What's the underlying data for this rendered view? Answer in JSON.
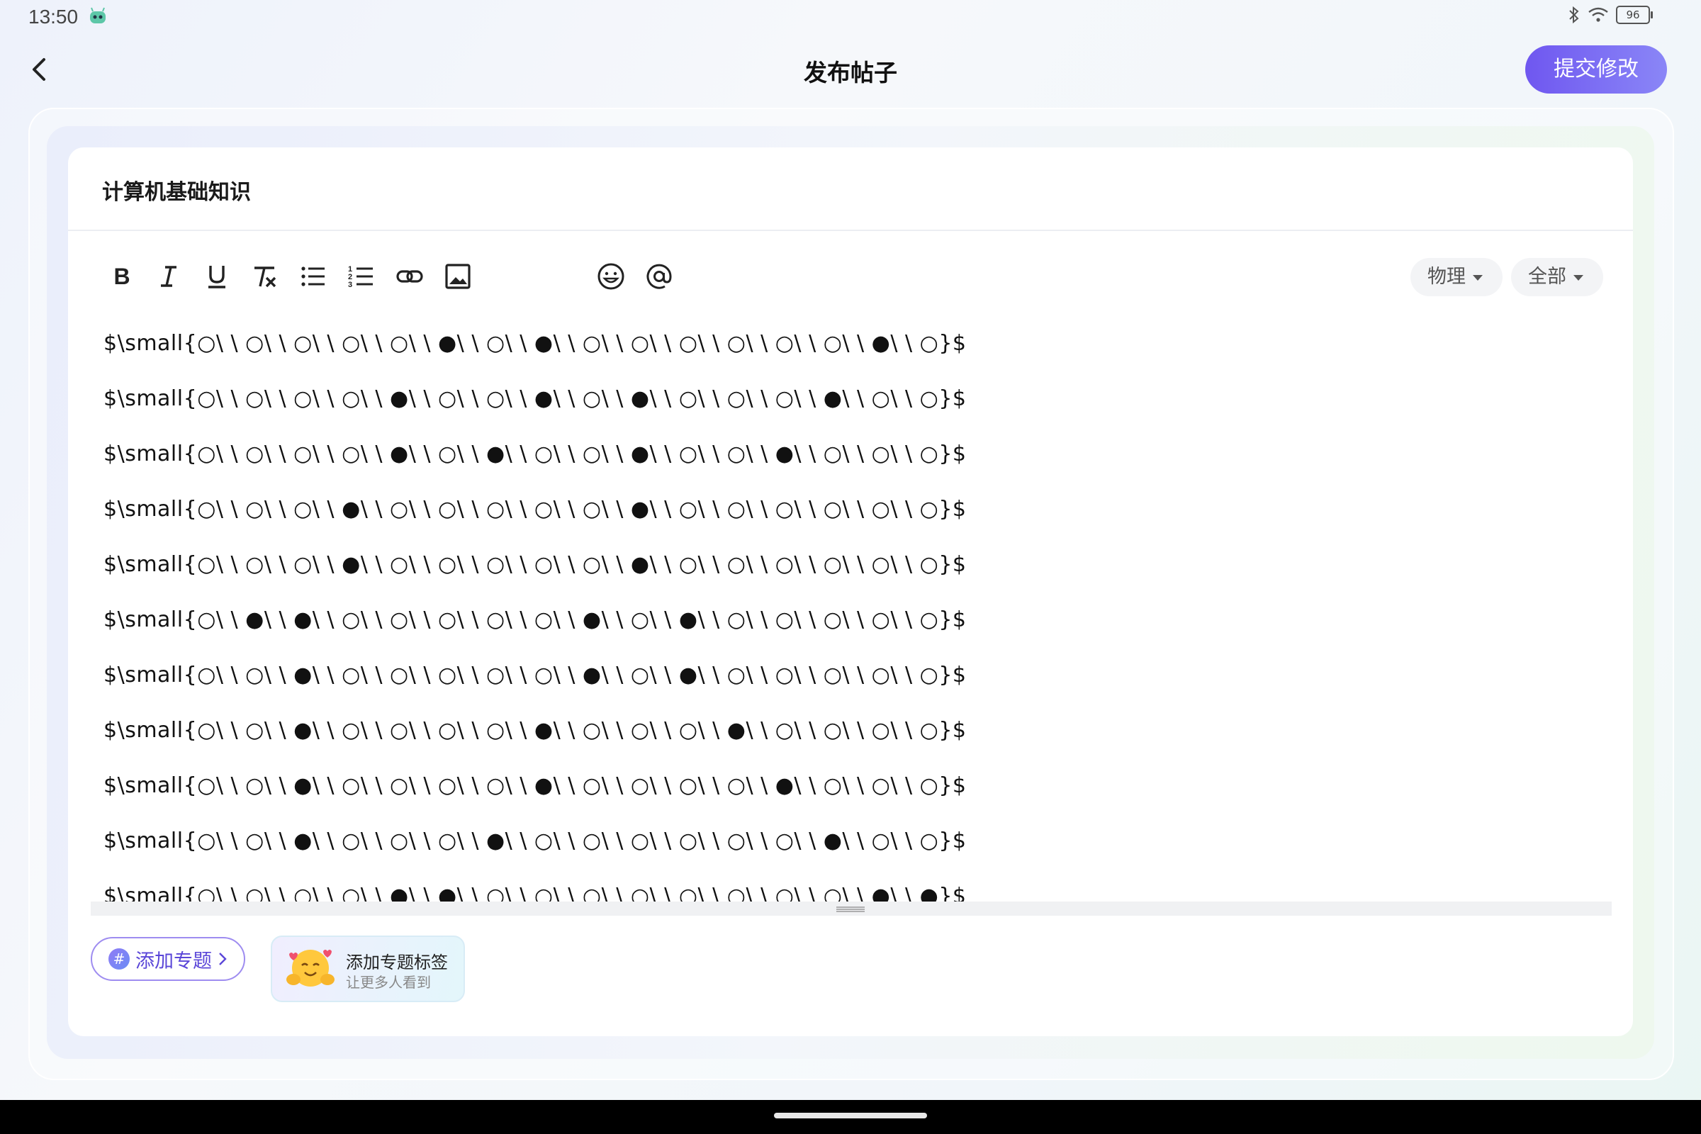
{
  "status_bar": {
    "time": "13:50",
    "battery_level": "96",
    "app_icon": "robot-face-icon",
    "icons": [
      "bluetooth-icon",
      "wifi-icon",
      "battery-icon"
    ]
  },
  "header": {
    "title": "发布帖子",
    "submit_label": "提交修改",
    "back_icon": "chevron-left-icon"
  },
  "post": {
    "title": "计算机基础知识"
  },
  "toolbar": {
    "icons": [
      "bold-icon",
      "italic-icon",
      "underline-icon",
      "clear-format-icon",
      "bullet-list-icon",
      "numbered-list-icon",
      "link-icon",
      "image-icon",
      "emoji-icon",
      "mention-icon"
    ],
    "category_label": "物理",
    "scope_label": "全部"
  },
  "content_lines": [
    "$\\small{○\\ \\ ○\\ \\ ○\\ \\ ○\\ \\ ○\\ \\ ●\\ \\ ○\\ \\ ●\\ \\ ○\\ \\ ○\\ \\ ○\\ \\ ○\\ \\ ○\\ \\ ○\\ \\ ●\\ \\ ○}$",
    "$\\small{○\\ \\ ○\\ \\ ○\\ \\ ○\\ \\ ●\\ \\ ○\\ \\ ○\\ \\ ●\\ \\ ○\\ \\ ●\\ \\ ○\\ \\ ○\\ \\ ○\\ \\ ●\\ \\ ○\\ \\ ○}$",
    "$\\small{○\\ \\ ○\\ \\ ○\\ \\ ○\\ \\ ●\\ \\ ○\\ \\ ●\\ \\ ○\\ \\ ○\\ \\ ●\\ \\ ○\\ \\ ○\\ \\ ●\\ \\ ○\\ \\ ○\\ \\ ○}$",
    "$\\small{○\\ \\ ○\\ \\ ○\\ \\ ●\\ \\ ○\\ \\ ○\\ \\ ○\\ \\ ○\\ \\ ○\\ \\ ●\\ \\ ○\\ \\ ○\\ \\ ○\\ \\ ○\\ \\ ○\\ \\ ○}$",
    "$\\small{○\\ \\ ○\\ \\ ○\\ \\ ●\\ \\ ○\\ \\ ○\\ \\ ○\\ \\ ○\\ \\ ○\\ \\ ●\\ \\ ○\\ \\ ○\\ \\ ○\\ \\ ○\\ \\ ○\\ \\ ○}$",
    "$\\small{○\\ \\ ●\\ \\ ●\\ \\ ○\\ \\ ○\\ \\ ○\\ \\ ○\\ \\ ○\\ \\ ●\\ \\ ○\\ \\ ●\\ \\ ○\\ \\ ○\\ \\ ○\\ \\ ○\\ \\ ○}$",
    "$\\small{○\\ \\ ○\\ \\ ●\\ \\ ○\\ \\ ○\\ \\ ○\\ \\ ○\\ \\ ○\\ \\ ●\\ \\ ○\\ \\ ●\\ \\ ○\\ \\ ○\\ \\ ○\\ \\ ○\\ \\ ○}$",
    "$\\small{○\\ \\ ○\\ \\ ●\\ \\ ○\\ \\ ○\\ \\ ○\\ \\ ○\\ \\ ●\\ \\ ○\\ \\ ○\\ \\ ○\\ \\ ●\\ \\ ○\\ \\ ○\\ \\ ○\\ \\ ○}$",
    "$\\small{○\\ \\ ○\\ \\ ●\\ \\ ○\\ \\ ○\\ \\ ○\\ \\ ○\\ \\ ●\\ \\ ○\\ \\ ○\\ \\ ○\\ \\ ○\\ \\ ●\\ \\ ○\\ \\ ○\\ \\ ○}$",
    "$\\small{○\\ \\ ○\\ \\ ●\\ \\ ○\\ \\ ○\\ \\ ○\\ \\ ●\\ \\ ○\\ \\ ○\\ \\ ○\\ \\ ○\\ \\ ○\\ \\ ○\\ \\ ●\\ \\ ○\\ \\ ○}$",
    "$\\small{○\\ \\ ○\\ \\ ○\\ \\ ○\\ \\ ●\\ \\ ●\\ \\ ○\\ \\ ○\\ \\ ○\\ \\ ○\\ \\ ○\\ \\ ○\\ \\ ○\\ \\ ○\\ \\ ●\\ \\ ●}$"
  ],
  "topic": {
    "button_label": "添加专题",
    "tip_title": "添加专题标签",
    "tip_subtitle": "让更多人看到",
    "tip_icon": "hugging-face-icon"
  }
}
